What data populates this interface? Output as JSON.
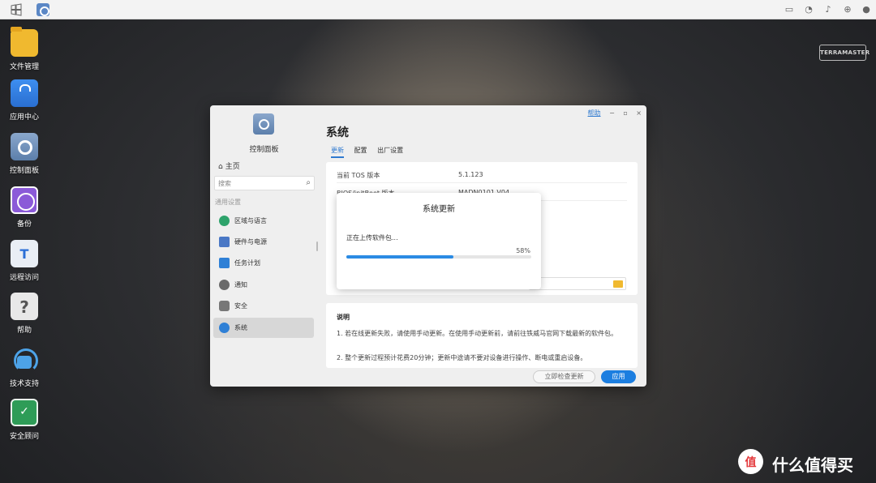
{
  "taskbar": {
    "start_icon": "windows-start-icon",
    "open_app_icon": "control-panel-icon",
    "tray_icons": [
      "desktop-icon",
      "chat-icon",
      "bell-icon",
      "globe-icon",
      "user-icon"
    ]
  },
  "desktop": {
    "brand": "TERRAMASTER",
    "icons": [
      {
        "label": "文件管理",
        "icon": "folder-icon"
      },
      {
        "label": "应用中心",
        "icon": "app-store-icon"
      },
      {
        "label": "控制面板",
        "icon": "control-panel-icon"
      },
      {
        "label": "备份",
        "icon": "backup-icon"
      },
      {
        "label": "远程访问",
        "icon": "remote-access-icon"
      },
      {
        "label": "帮助",
        "icon": "help-icon"
      },
      {
        "label": "技术支持",
        "icon": "headset-icon"
      },
      {
        "label": "安全顾问",
        "icon": "shield-icon"
      }
    ]
  },
  "window": {
    "help_link": "帮助",
    "controls": [
      "−",
      "▫",
      "×"
    ],
    "sidebar": {
      "app_title": "控制面板",
      "home": "主页",
      "search_placeholder": "搜索",
      "section_label": "通用设置",
      "items": [
        {
          "label": "区域与语言",
          "icon": "globe-icon",
          "color": "#2ea36b"
        },
        {
          "label": "硬件与电源",
          "icon": "tools-icon",
          "color": "#4a78c5"
        },
        {
          "label": "任务计划",
          "icon": "calendar-icon",
          "color": "#2f80d6"
        },
        {
          "label": "通知",
          "icon": "message-icon",
          "color": "#6a6a6a"
        },
        {
          "label": "安全",
          "icon": "lock-icon",
          "color": "#777777"
        },
        {
          "label": "系统",
          "icon": "system-icon",
          "color": "#2f80d6"
        }
      ]
    },
    "main": {
      "title": "系统",
      "tabs": [
        "更新",
        "配置",
        "出厂设置"
      ],
      "active_tab": "更新",
      "info_rows": [
        {
          "key": "当前 TOS 版本",
          "value": "5.1.123"
        },
        {
          "key": "BIOS/initBoot 版本",
          "value": "MADN0101 V04"
        }
      ],
      "notes": {
        "heading": "说明",
        "items": [
          "1. 若在线更新失败，请使用手动更新。在使用手动更新前，请前往铁威马官网下载最新的软件包。",
          "2. 整个更新过程预计花费20分钟；更新中途请不要对设备进行操作、断电或重启设备。"
        ]
      },
      "buttons": {
        "check": "立即检查更新",
        "apply": "应用"
      }
    }
  },
  "modal": {
    "title": "系统更新",
    "status": "正在上传软件包...",
    "percent_label": "58%",
    "progress": 0.58,
    "accent_color": "#2b8be4"
  },
  "watermark": {
    "text": "什么值得买",
    "icon": "zhide-logo-icon"
  }
}
